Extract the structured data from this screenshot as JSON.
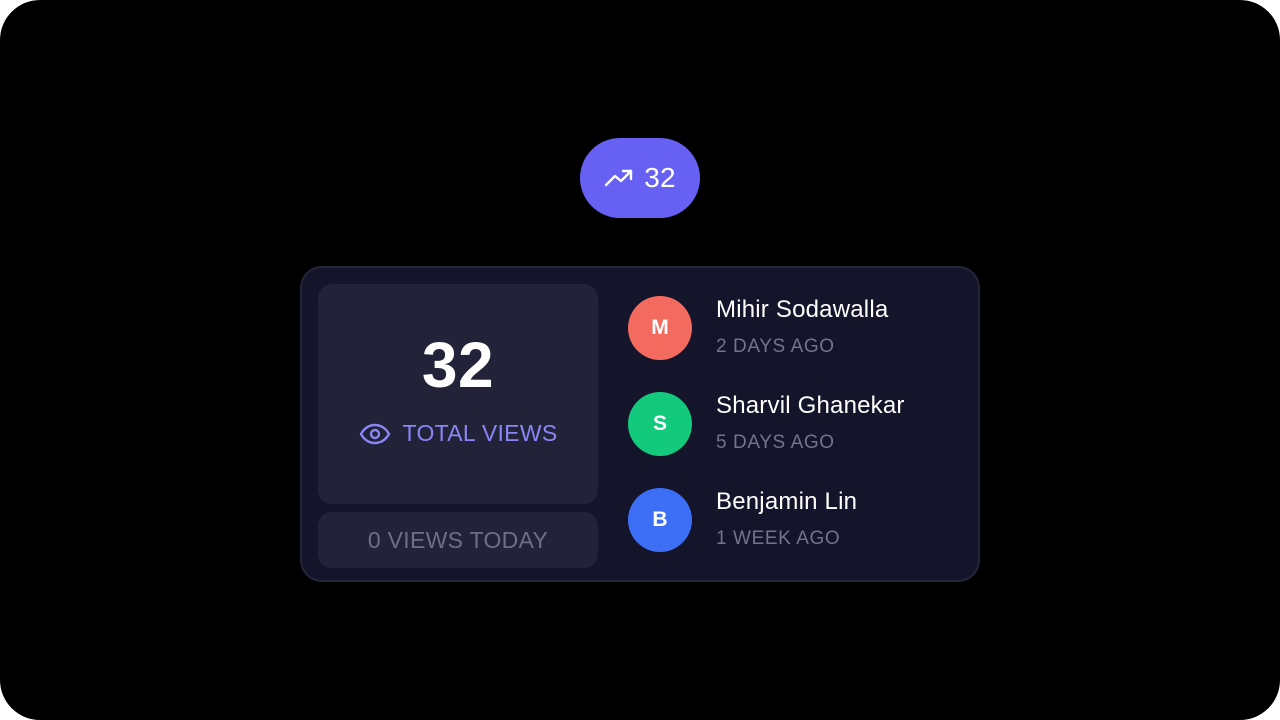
{
  "badge": {
    "icon": "trending-up-icon",
    "count": "32",
    "color": "#6661f2"
  },
  "stats": {
    "total": "32",
    "total_label": "TOTAL VIEWS",
    "total_icon": "eye-icon",
    "today_label": "0 VIEWS TODAY",
    "accent": "#8b86f5"
  },
  "viewers": [
    {
      "initial": "M",
      "name": "Mihir Sodawalla",
      "time": "2 DAYS AGO",
      "color": "#f26b5e"
    },
    {
      "initial": "S",
      "name": "Sharvil Ghanekar",
      "time": "5 DAYS AGO",
      "color": "#12c97c"
    },
    {
      "initial": "B",
      "name": "Benjamin Lin",
      "time": "1 WEEK AGO",
      "color": "#3d6ff6"
    }
  ]
}
